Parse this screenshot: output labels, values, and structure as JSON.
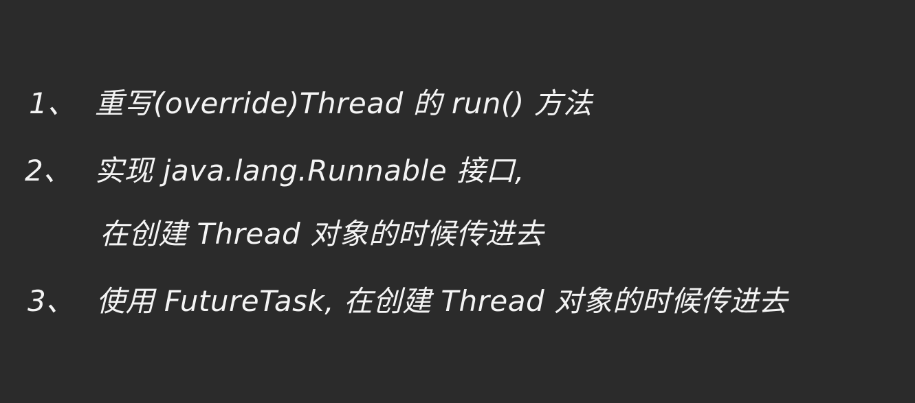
{
  "notes": {
    "item1_number": "1、",
    "item1_text": "重写(override)Thread 的 run() 方法",
    "item2_number": "2、",
    "item2_text": "实现 java.lang.Runnable 接口,",
    "item2_continuation": "在创建 Thread 对象的时候传进去",
    "item3_number": "3、",
    "item3_text": "使用 FutureTask, 在创建 Thread 对象的时候传进去"
  },
  "colors": {
    "background": "#2b2b2b",
    "ink": "#f4f4f4"
  }
}
